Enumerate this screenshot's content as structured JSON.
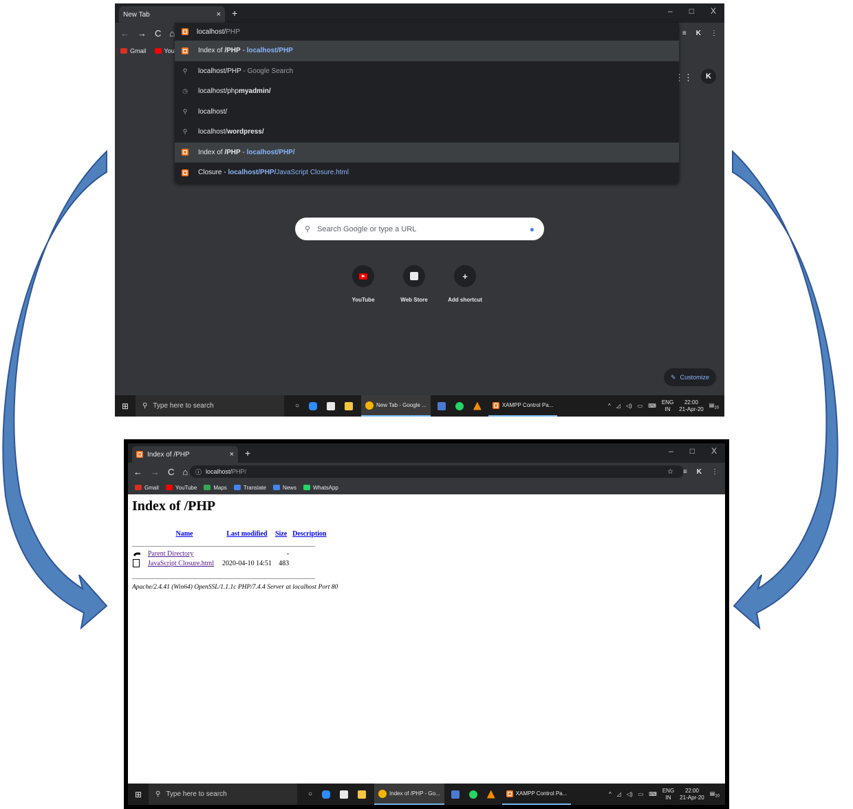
{
  "top": {
    "tab_title": "New Tab",
    "tab_close": "×",
    "new_tab": "+",
    "window_controls": [
      "–",
      "□",
      "X"
    ],
    "omnibox_value": "localhost/",
    "omnibox_autocomplete": "PHP",
    "bookmarks": [
      {
        "label": "Gmail",
        "color": "#d93025"
      },
      {
        "label": "YouT",
        "color": "#ff0000"
      }
    ],
    "suggestions": [
      {
        "icon": "xampp-icon",
        "parts": [
          "Index of ",
          "/PHP",
          " - ",
          "localhost/PHP",
          ""
        ],
        "selected": true
      },
      {
        "icon": "search-icon",
        "parts": [
          "localhost/PHP",
          "",
          " - Google Search",
          "",
          ""
        ],
        "selected": false
      },
      {
        "icon": "history-icon",
        "parts": [
          "localhost/php",
          "myadmin/",
          "",
          "",
          ""
        ],
        "selected": false
      },
      {
        "icon": "search-icon",
        "parts": [
          "localhost/",
          "",
          "",
          "",
          ""
        ],
        "selected": false
      },
      {
        "icon": "search-icon",
        "parts": [
          "localhost/",
          "wordpress/",
          "",
          "",
          ""
        ],
        "selected": false
      },
      {
        "icon": "xampp-icon",
        "parts": [
          "Index of ",
          "/PHP",
          " - ",
          "localhost/PHP/",
          ""
        ],
        "selected": true
      },
      {
        "icon": "xampp-icon",
        "parts": [
          "Closure",
          "",
          " - ",
          "localhost/PHP/",
          "JavaScript Closure.html"
        ],
        "selected": false
      }
    ],
    "search_placeholder": "Search Google or type a URL",
    "shortcuts": [
      {
        "label": "YouTube",
        "icon": "youtube-icon"
      },
      {
        "label": "Web Store",
        "icon": "web-store-icon"
      },
      {
        "label": "Add shortcut",
        "icon": "plus-icon",
        "glyph": "+"
      }
    ],
    "customize_label": "Customize",
    "avatar_text": "K",
    "taskbar": {
      "search_placeholder": "Type here to search",
      "apps": [
        {
          "label": "New Tab - Google ...",
          "color": "#f4b400"
        },
        {
          "label": "XAMPP Control Pa...",
          "color": "#fb7a24"
        }
      ],
      "lang_top": "ENG",
      "lang_bottom": "IN",
      "time": "22:00",
      "date": "21-Apr-20",
      "notif": "10"
    }
  },
  "bottom": {
    "tab_title": "Index of /PHP",
    "tab_close": "×",
    "new_tab": "+",
    "window_controls": [
      "–",
      "□",
      "X"
    ],
    "url_host": "localhost/",
    "url_path": "PHP/",
    "bookmarks": [
      {
        "label": "Gmail",
        "color": "#d93025"
      },
      {
        "label": "YouTube",
        "color": "#ff0000"
      },
      {
        "label": "Maps",
        "color": "#34a853"
      },
      {
        "label": "Translate",
        "color": "#4285f4"
      },
      {
        "label": "News",
        "color": "#4285f4"
      },
      {
        "label": "WhatsApp",
        "color": "#25d366"
      }
    ],
    "page_title": "Index of /PHP",
    "columns": [
      "Name",
      "Last modified",
      "Size",
      "Description"
    ],
    "rows": [
      {
        "icon": "back-arrow-icon",
        "name": "Parent Directory",
        "modified": "",
        "size": "-",
        "description": ""
      },
      {
        "icon": "file-icon",
        "name": "JavaScript Closure.html",
        "modified": "2020-04-10 14:51",
        "size": "483",
        "description": ""
      }
    ],
    "footer": "Apache/2.4.41 (Win64) OpenSSL/1.1.1c PHP/7.4.4 Server at localhost Port 80",
    "taskbar": {
      "search_placeholder": "Type here to search",
      "apps": [
        {
          "label": "Index of /PHP - Go...",
          "color": "#f4b400"
        },
        {
          "label": "XAMPP Control Pa...",
          "color": "#fb7a24"
        }
      ],
      "lang_top": "ENG",
      "lang_bottom": "IN",
      "time": "22:00",
      "date": "21-Apr-20",
      "notif": "10"
    }
  },
  "colors": {
    "arrow_fill": "#4f81bd",
    "arrow_stroke": "#2f5597",
    "chrome_dark": "#35363a",
    "link_blue": "#8ab4f8"
  }
}
